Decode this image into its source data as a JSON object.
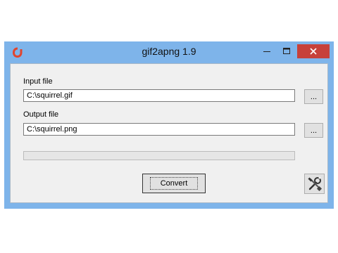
{
  "window": {
    "title": "gif2apng 1.9",
    "app_icon": "gif2apng-logo-icon",
    "minimize_icon": "minimize-icon",
    "maximize_icon": "maximize-icon",
    "close_icon": "close-icon"
  },
  "form": {
    "input_label": "Input file",
    "input_value": "C:\\squirrel.gif",
    "output_label": "Output file",
    "output_value": "C:\\squirrel.png",
    "browse_label": "...",
    "progress": 0,
    "convert_label": "Convert",
    "settings_icon": "tools-icon"
  },
  "colors": {
    "titlebar": "#7eb4ea",
    "close": "#c7413a",
    "logo": "#e0452e"
  }
}
